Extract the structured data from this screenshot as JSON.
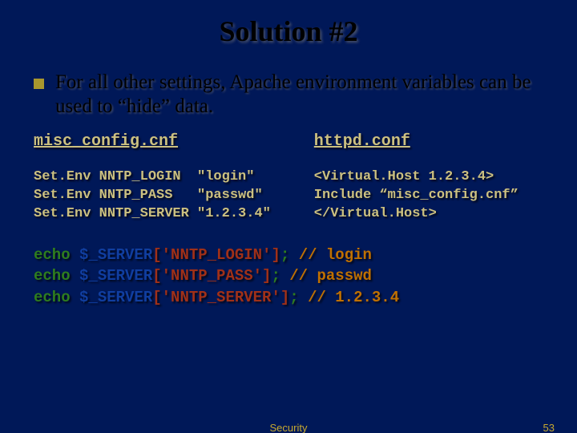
{
  "title": "Solution #2",
  "bullet": "For all other settings, Apache environment variables can be used to “hide” data.",
  "left": {
    "file": "misc_config.cnf",
    "code": "Set.Env NNTP_LOGIN  \"login\"\nSet.Env NNTP_PASS   \"passwd\"\nSet.Env NNTP_SERVER \"1.2.3.4\""
  },
  "right": {
    "file": "httpd.conf",
    "code": "<Virtual.Host 1.2.3.4>\nInclude “misc_config.cnf”\n</Virtual.Host>"
  },
  "php": [
    {
      "pre": "echo ",
      "var": "$_SERVER",
      "idx": "['NNTP_LOGIN']",
      "post": "; ",
      "cmt": "// login"
    },
    {
      "pre": "echo ",
      "var": "$_SERVER",
      "idx": "['NNTP_PASS']",
      "post": "; ",
      "cmt": "// passwd"
    },
    {
      "pre": "echo ",
      "var": "$_SERVER",
      "idx": "['NNTP_SERVER']",
      "post": "; ",
      "cmt": "// 1.2.3.4"
    }
  ],
  "footer": {
    "center": "Security",
    "page": "53"
  }
}
